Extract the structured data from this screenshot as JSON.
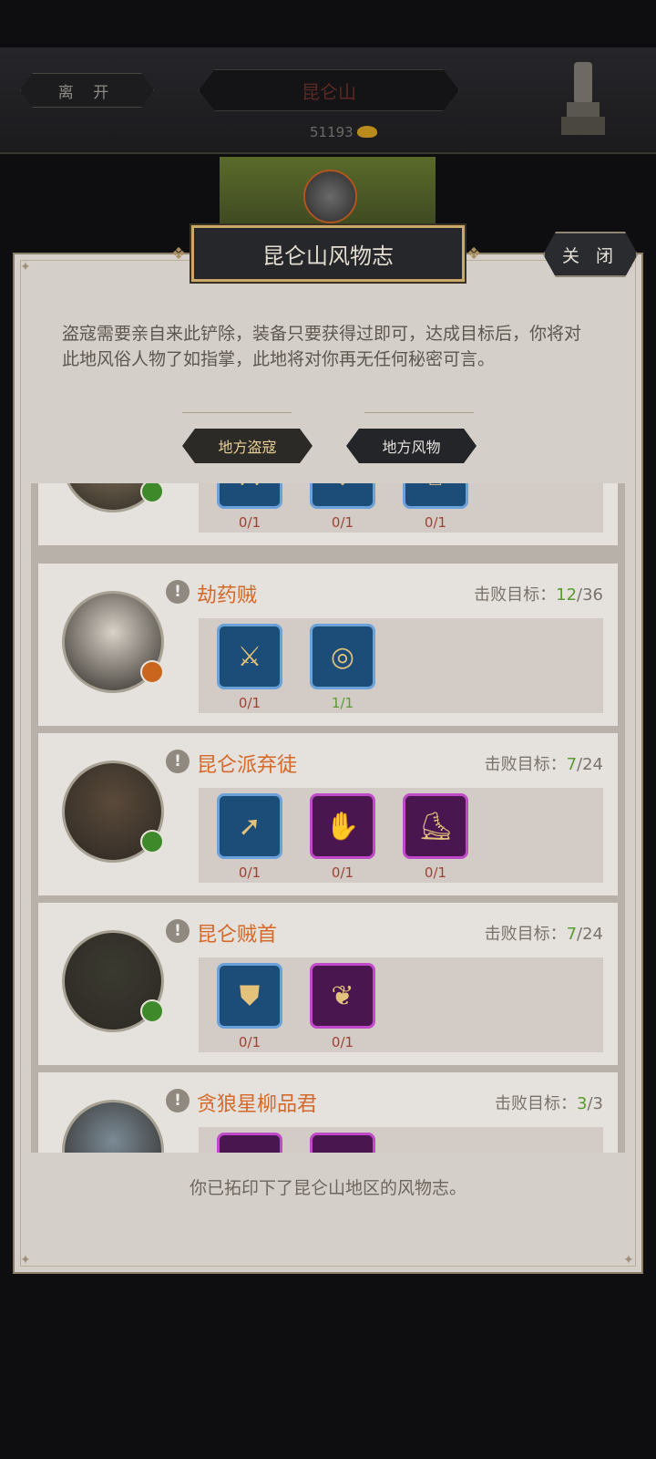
{
  "topbar": {
    "leave_label": "离 开",
    "location_name": "昆仑山",
    "money": "51193",
    "money_icon": "gold-ingot-icon",
    "statue_icon": "stone-statue-icon"
  },
  "panel": {
    "title": "昆仑山风物志",
    "close_label": "关 闭",
    "intro": "盗寇需要亲自来此铲除，装备只要获得过即可，达成目标后，你将对此地风俗人物了如指掌，此地将对你再无任何秘密可言。",
    "tabs": [
      "地方盗寇",
      "地方风物"
    ],
    "footer": "你已拓印下了昆仑山地区的风物志。"
  },
  "goal_label": "击败目标：",
  "cards": [
    {
      "name": "",
      "cur": "",
      "total": "",
      "badge_color": "#3e8a2a",
      "items": [
        {
          "color": "blue",
          "icon": "sword-icon",
          "count": "0/1"
        },
        {
          "color": "blue",
          "icon": "armor-icon",
          "count": "0/1"
        },
        {
          "color": "blue",
          "icon": "helmet-icon",
          "count": "0/1"
        }
      ]
    },
    {
      "name": "劫药贼",
      "cur": "12",
      "total": "/36",
      "badge_color": "#c9651c",
      "items": [
        {
          "color": "blue",
          "icon": "saber-icon",
          "count": "0/1"
        },
        {
          "color": "blue",
          "icon": "bracelet-icon",
          "count": "1/1"
        }
      ]
    },
    {
      "name": "昆仑派弃徒",
      "cur": "7",
      "total": "/24",
      "badge_color": "#3e8a2a",
      "items": [
        {
          "color": "blue",
          "icon": "spear-icon",
          "count": "0/1"
        },
        {
          "color": "purple",
          "icon": "gauntlet-icon",
          "count": "0/1"
        },
        {
          "color": "purple",
          "icon": "boots-icon",
          "count": "0/1"
        }
      ]
    },
    {
      "name": "昆仑贼首",
      "cur": "7",
      "total": "/24",
      "badge_color": "#3e8a2a",
      "items": [
        {
          "color": "blue",
          "icon": "bracer-icon",
          "count": "0/1"
        },
        {
          "color": "purple",
          "icon": "necklace-icon",
          "count": "0/1"
        }
      ]
    },
    {
      "name": "贪狼星柳品君",
      "cur": "3",
      "total": "/3",
      "badge_color": "#3e8a2a",
      "items": [
        {
          "color": "purple",
          "icon": "blade-icon",
          "count": ""
        },
        {
          "color": "purple",
          "icon": "ring-icon",
          "count": ""
        }
      ]
    }
  ]
}
